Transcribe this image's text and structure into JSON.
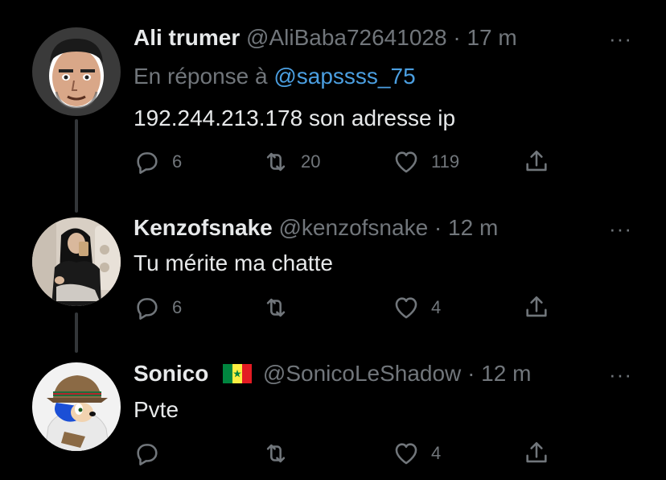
{
  "tweets": [
    {
      "name": "Ali trumer",
      "handle": "@AliBaba72641028",
      "separator": "·",
      "time": "17 m",
      "reply_prefix": "En réponse à",
      "reply_mention": "@sapssss_75",
      "text": "192.244.213.178 son adresse ip",
      "replies": "6",
      "retweets": "20",
      "likes": "119",
      "avatar_icon": "cartoon-man-avatar",
      "has_flag": false
    },
    {
      "name": "Kenzofsnake",
      "handle": "@kenzofsnake",
      "separator": "·",
      "time": "12 m",
      "text": "Tu mérite ma chatte",
      "replies": "6",
      "retweets": "",
      "likes": "4",
      "avatar_icon": "photo-avatar",
      "has_flag": false
    },
    {
      "name": "Sonico",
      "handle": "@SonicoLeShadow",
      "separator": "·",
      "time": "12 m",
      "text": "Pvte",
      "replies": "",
      "retweets": "",
      "likes": "4",
      "avatar_icon": "sonic-avatar",
      "has_flag": true,
      "flag_icon": "senegal-flag-icon"
    }
  ],
  "more_label": "···",
  "colors": {
    "background": "#000000",
    "primary_text": "#e7e9ea",
    "secondary_text": "#71767b",
    "link": "#4b9fe1",
    "thread_line": "#333639"
  }
}
